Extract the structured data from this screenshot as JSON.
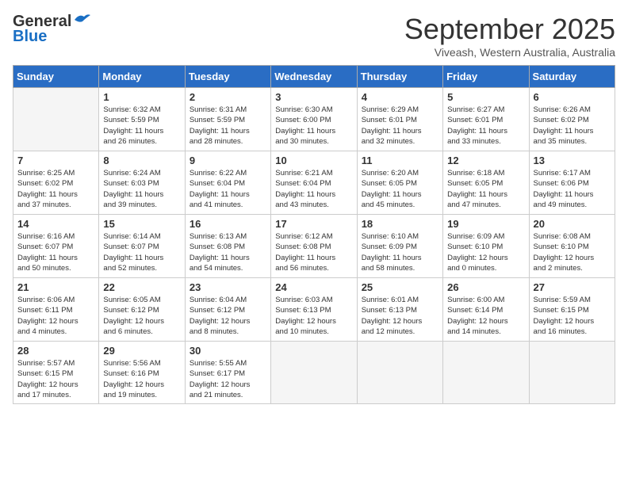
{
  "header": {
    "logo_line1": "General",
    "logo_line2": "Blue",
    "title": "September 2025",
    "subtitle": "Viveash, Western Australia, Australia"
  },
  "days_of_week": [
    "Sunday",
    "Monday",
    "Tuesday",
    "Wednesday",
    "Thursday",
    "Friday",
    "Saturday"
  ],
  "weeks": [
    [
      {
        "day": "",
        "info": ""
      },
      {
        "day": "1",
        "info": "Sunrise: 6:32 AM\nSunset: 5:59 PM\nDaylight: 11 hours\nand 26 minutes."
      },
      {
        "day": "2",
        "info": "Sunrise: 6:31 AM\nSunset: 5:59 PM\nDaylight: 11 hours\nand 28 minutes."
      },
      {
        "day": "3",
        "info": "Sunrise: 6:30 AM\nSunset: 6:00 PM\nDaylight: 11 hours\nand 30 minutes."
      },
      {
        "day": "4",
        "info": "Sunrise: 6:29 AM\nSunset: 6:01 PM\nDaylight: 11 hours\nand 32 minutes."
      },
      {
        "day": "5",
        "info": "Sunrise: 6:27 AM\nSunset: 6:01 PM\nDaylight: 11 hours\nand 33 minutes."
      },
      {
        "day": "6",
        "info": "Sunrise: 6:26 AM\nSunset: 6:02 PM\nDaylight: 11 hours\nand 35 minutes."
      }
    ],
    [
      {
        "day": "7",
        "info": "Sunrise: 6:25 AM\nSunset: 6:02 PM\nDaylight: 11 hours\nand 37 minutes."
      },
      {
        "day": "8",
        "info": "Sunrise: 6:24 AM\nSunset: 6:03 PM\nDaylight: 11 hours\nand 39 minutes."
      },
      {
        "day": "9",
        "info": "Sunrise: 6:22 AM\nSunset: 6:04 PM\nDaylight: 11 hours\nand 41 minutes."
      },
      {
        "day": "10",
        "info": "Sunrise: 6:21 AM\nSunset: 6:04 PM\nDaylight: 11 hours\nand 43 minutes."
      },
      {
        "day": "11",
        "info": "Sunrise: 6:20 AM\nSunset: 6:05 PM\nDaylight: 11 hours\nand 45 minutes."
      },
      {
        "day": "12",
        "info": "Sunrise: 6:18 AM\nSunset: 6:05 PM\nDaylight: 11 hours\nand 47 minutes."
      },
      {
        "day": "13",
        "info": "Sunrise: 6:17 AM\nSunset: 6:06 PM\nDaylight: 11 hours\nand 49 minutes."
      }
    ],
    [
      {
        "day": "14",
        "info": "Sunrise: 6:16 AM\nSunset: 6:07 PM\nDaylight: 11 hours\nand 50 minutes."
      },
      {
        "day": "15",
        "info": "Sunrise: 6:14 AM\nSunset: 6:07 PM\nDaylight: 11 hours\nand 52 minutes."
      },
      {
        "day": "16",
        "info": "Sunrise: 6:13 AM\nSunset: 6:08 PM\nDaylight: 11 hours\nand 54 minutes."
      },
      {
        "day": "17",
        "info": "Sunrise: 6:12 AM\nSunset: 6:08 PM\nDaylight: 11 hours\nand 56 minutes."
      },
      {
        "day": "18",
        "info": "Sunrise: 6:10 AM\nSunset: 6:09 PM\nDaylight: 11 hours\nand 58 minutes."
      },
      {
        "day": "19",
        "info": "Sunrise: 6:09 AM\nSunset: 6:10 PM\nDaylight: 12 hours\nand 0 minutes."
      },
      {
        "day": "20",
        "info": "Sunrise: 6:08 AM\nSunset: 6:10 PM\nDaylight: 12 hours\nand 2 minutes."
      }
    ],
    [
      {
        "day": "21",
        "info": "Sunrise: 6:06 AM\nSunset: 6:11 PM\nDaylight: 12 hours\nand 4 minutes."
      },
      {
        "day": "22",
        "info": "Sunrise: 6:05 AM\nSunset: 6:12 PM\nDaylight: 12 hours\nand 6 minutes."
      },
      {
        "day": "23",
        "info": "Sunrise: 6:04 AM\nSunset: 6:12 PM\nDaylight: 12 hours\nand 8 minutes."
      },
      {
        "day": "24",
        "info": "Sunrise: 6:03 AM\nSunset: 6:13 PM\nDaylight: 12 hours\nand 10 minutes."
      },
      {
        "day": "25",
        "info": "Sunrise: 6:01 AM\nSunset: 6:13 PM\nDaylight: 12 hours\nand 12 minutes."
      },
      {
        "day": "26",
        "info": "Sunrise: 6:00 AM\nSunset: 6:14 PM\nDaylight: 12 hours\nand 14 minutes."
      },
      {
        "day": "27",
        "info": "Sunrise: 5:59 AM\nSunset: 6:15 PM\nDaylight: 12 hours\nand 16 minutes."
      }
    ],
    [
      {
        "day": "28",
        "info": "Sunrise: 5:57 AM\nSunset: 6:15 PM\nDaylight: 12 hours\nand 17 minutes."
      },
      {
        "day": "29",
        "info": "Sunrise: 5:56 AM\nSunset: 6:16 PM\nDaylight: 12 hours\nand 19 minutes."
      },
      {
        "day": "30",
        "info": "Sunrise: 5:55 AM\nSunset: 6:17 PM\nDaylight: 12 hours\nand 21 minutes."
      },
      {
        "day": "",
        "info": ""
      },
      {
        "day": "",
        "info": ""
      },
      {
        "day": "",
        "info": ""
      },
      {
        "day": "",
        "info": ""
      }
    ]
  ]
}
